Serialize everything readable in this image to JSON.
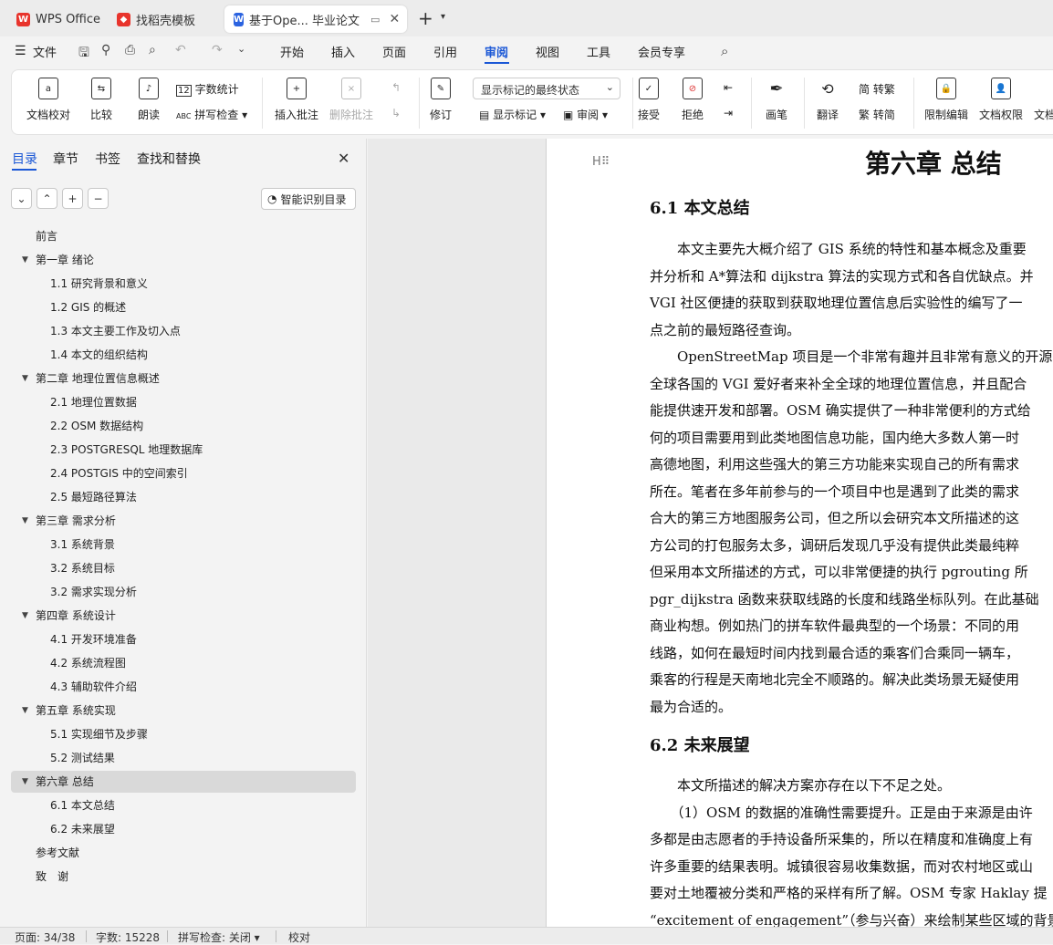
{
  "tabs": [
    {
      "label": "WPS Office"
    },
    {
      "label": "找稻壳模板"
    },
    {
      "label": "基于Ope... 毕业论文"
    }
  ],
  "menubar": {
    "file": "文件",
    "items": [
      "开始",
      "插入",
      "页面",
      "引用",
      "审阅",
      "视图",
      "工具",
      "会员专享"
    ],
    "active": "审阅"
  },
  "ribbon": {
    "doc_check": "文档校对",
    "compare": "比较",
    "read_aloud": "朗读",
    "word_count": "字数统计",
    "spell_check": "拼写检查",
    "insert_comment": "插入批注",
    "delete_comment": "删除批注",
    "track": "修订",
    "markup_state": "显示标记的最终状态",
    "show_markup": "显示标记",
    "review": "审阅",
    "accept": "接受",
    "reject": "拒绝",
    "pen": "画笔",
    "translate": "翻译",
    "to_traditional": "简 转繁",
    "to_simplified": "繁 转简",
    "restrict_edit": "限制编辑",
    "doc_permission": "文档权限",
    "doc_more": "文档"
  },
  "nav": {
    "tabs": [
      "目录",
      "章节",
      "书签",
      "查找和替换"
    ],
    "smart_toc": "智能识别目录",
    "items": [
      {
        "label": "前言",
        "level": 1,
        "expand": false
      },
      {
        "label": "第一章 绪论",
        "level": 1,
        "expand": true
      },
      {
        "label": "1.1 研究背景和意义",
        "level": 2
      },
      {
        "label": "1.2 GIS 的概述",
        "level": 2
      },
      {
        "label": "1.3 本文主要工作及切入点",
        "level": 2
      },
      {
        "label": "1.4 本文的组织结构",
        "level": 2
      },
      {
        "label": "第二章 地理位置信息概述",
        "level": 1,
        "expand": true
      },
      {
        "label": "2.1 地理位置数据",
        "level": 2
      },
      {
        "label": "2.2 OSM 数据结构",
        "level": 2
      },
      {
        "label": "2.3 POSTGRESQL 地理数据库",
        "level": 2
      },
      {
        "label": "2.4 POSTGIS 中的空间索引",
        "level": 2
      },
      {
        "label": "2.5 最短路径算法",
        "level": 2
      },
      {
        "label": "第三章 需求分析",
        "level": 1,
        "expand": true
      },
      {
        "label": "3.1 系统背景",
        "level": 2
      },
      {
        "label": "3.2 系统目标",
        "level": 2
      },
      {
        "label": "3.2 需求实现分析",
        "level": 2
      },
      {
        "label": "第四章 系统设计",
        "level": 1,
        "expand": true
      },
      {
        "label": "4.1 开发环境准备",
        "level": 2
      },
      {
        "label": "4.2 系统流程图",
        "level": 2
      },
      {
        "label": "4.3 辅助软件介绍",
        "level": 2
      },
      {
        "label": "第五章 系统实现",
        "level": 1,
        "expand": true
      },
      {
        "label": "5.1 实现细节及步骤",
        "level": 2
      },
      {
        "label": "5.2 测试结果",
        "level": 2
      },
      {
        "label": "第六章 总结",
        "level": 1,
        "expand": true,
        "selected": true
      },
      {
        "label": "6.1 本文总结",
        "level": 2
      },
      {
        "label": "6.2 未来展望",
        "level": 2
      },
      {
        "label": "参考文献",
        "level": 1
      },
      {
        "label": "致　谢",
        "level": 1
      }
    ]
  },
  "document": {
    "chapter_title": "第六章 总结",
    "sec1_title": "6.1 本文总结",
    "sec1_lines": [
      "　　本文主要先大概介绍了 GIS 系统的特性和基本概念及重要",
      "并分析和 A*算法和 dijkstra 算法的实现方式和各自优缺点。并",
      "VGI 社区便捷的获取到获取地理位置信息后实验性的编写了一",
      "点之前的最短路径查询。",
      "　　OpenStreetMap 项目是一个非常有趣并且非常有意义的开源",
      "全球各国的 VGI 爱好者来补全全球的地理位置信息，并且配合",
      "能提供速开发和部署。OSM 确实提供了一种非常便利的方式给",
      "何的项目需要用到此类地图信息功能，国内绝大多数人第一时",
      "高德地图，利用这些强大的第三方功能来实现自己的所有需求",
      "所在。笔者在多年前参与的一个项目中也是遇到了此类的需求",
      "合大的第三方地图服务公司，但之所以会研究本文所描述的这",
      "方公司的打包服务太多，调研后发现几乎没有提供此类最纯粹",
      "但采用本文所描述的方式，可以非常便捷的执行 pgrouting 所",
      "pgr_dijkstra 函数来获取线路的长度和线路坐标队列。在此基础",
      "商业构想。例如热门的拼车软件最典型的一个场景：不同的用",
      "线路，如何在最短时间内找到最合适的乘客们合乘同一辆车，",
      "乘客的行程是天南地北完全不顺路的。解决此类场景无疑使用",
      "最为合适的。"
    ],
    "sec2_title": "6.2 未来展望",
    "sec2_lines": [
      "　　本文所描述的解决方案亦存在以下不足之处。",
      "　　（1）OSM 的数据的准确性需要提升。正是由于来源是由许",
      "多都是由志愿者的手持设备所采集的，所以在精度和准确度上有",
      "许多重要的结果表明。城镇很容易收集数据，而对农村地区或山",
      "要对土地覆被分类和严格的采样有所了解。OSM 专家 Haklay 提",
      "“excitement of engagement”（参与兴奋）来绘制某些区域的背景"
    ]
  },
  "status": {
    "page": "页面: 34/38",
    "words": "字数: 15228",
    "spell": "拼写检查: 关闭",
    "proof": "校对"
  }
}
